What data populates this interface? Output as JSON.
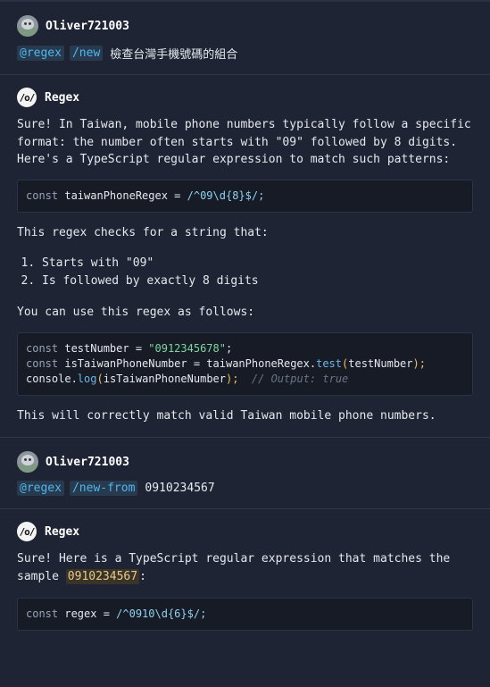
{
  "messages": [
    {
      "user": "Oliver721003",
      "tags": [
        "@regex",
        "/new"
      ],
      "text": "檢查台灣手機號碼的組合"
    },
    {
      "bot": "Regex",
      "logo": "/o/",
      "intro": "Sure! In Taiwan, mobile phone numbers typically follow a specific format: the number often starts with \"09\" followed by 8 digits. Here's a TypeScript regular expression to match such patterns:",
      "code1": {
        "kw": "const",
        "ident": " taiwanPhoneRegex = ",
        "regex": "/^09\\d{8}$/;"
      },
      "checks_intro": "This regex checks for a string that:",
      "checks": [
        "Starts with \"09\"",
        "Is followed by exactly 8 digits"
      ],
      "usage_intro": "You can use this regex as follows:",
      "code2": {
        "l1_kw": "const",
        "l1_id": " testNumber = ",
        "l1_str": "\"0912345678\"",
        "l1_end": ";",
        "l2_kw": "const",
        "l2_id": " isTaiwanPhoneNumber = taiwanPhoneRegex.",
        "l2_fn": "test",
        "l2_p1": "(",
        "l2_arg": "testNumber",
        "l2_p2": ");",
        "l3_id": "console.",
        "l3_fn": "log",
        "l3_p1": "(",
        "l3_arg": "isTaiwanPhoneNumber",
        "l3_p2": ");",
        "l3_cm": "  // Output: true"
      },
      "outro": "This will correctly match valid Taiwan mobile phone numbers."
    },
    {
      "user": "Oliver721003",
      "tags": [
        "@regex",
        "/new-from"
      ],
      "text": "0910234567"
    },
    {
      "bot": "Regex",
      "logo": "/o/",
      "intro_a": "Sure! Here is a TypeScript regular expression that matches the sample ",
      "intro_code": "0910234567",
      "intro_b": ":",
      "code1": {
        "kw": "const",
        "ident": " regex = ",
        "regex": "/^0910\\d{6}$/;"
      }
    }
  ]
}
